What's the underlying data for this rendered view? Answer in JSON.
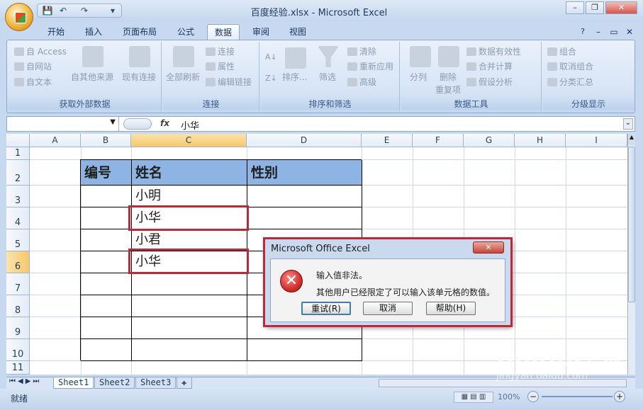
{
  "window": {
    "title": "百度经验.xlsx - Microsoft Excel",
    "minimize": "▭",
    "restore": "▭",
    "close": "✕"
  },
  "tabs": [
    "开始",
    "插入",
    "页面布局",
    "公式",
    "数据",
    "审阅",
    "视图"
  ],
  "active_tab": "数据",
  "ribbon": {
    "external": {
      "title": "获取外部数据",
      "access": "自 Access",
      "web": "自网站",
      "text": "自文本",
      "other": "自其他来源",
      "existing": "现有连接"
    },
    "connections": {
      "title": "连接",
      "refresh": "全部刷新",
      "conn": "连接",
      "props": "属性",
      "edit": "编辑链接"
    },
    "sort": {
      "title": "排序和筛选",
      "sort": "排序...",
      "filter": "筛选",
      "clear": "清除",
      "reapply": "重新应用",
      "advanced": "高级"
    },
    "tools": {
      "title": "数据工具",
      "split": "分列",
      "dedup1": "删除",
      "dedup2": "重复项",
      "validation": "数据有效性",
      "consolidate": "合并计算",
      "whatif": "假设分析"
    },
    "outline": {
      "title": "分级显示",
      "group": "组合",
      "ungroup": "取消组合",
      "subtotal": "分类汇总"
    }
  },
  "formula": {
    "fx": "fx",
    "value": "小华"
  },
  "columns": [
    "A",
    "B",
    "C",
    "D",
    "E",
    "F",
    "G",
    "H",
    "I"
  ],
  "selected_column": "C",
  "rows": [
    "1",
    "2",
    "3",
    "4",
    "5",
    "6",
    "7",
    "8",
    "9",
    "10",
    "11"
  ],
  "selected_row": "6",
  "table": {
    "headers": [
      "编号",
      "姓名",
      "性别"
    ],
    "names": [
      "小明",
      "小华",
      "小君",
      "小华",
      "",
      "",
      "",
      ""
    ]
  },
  "sheets": [
    "Sheet1",
    "Sheet2",
    "Sheet3"
  ],
  "status": {
    "ready": "就绪",
    "zoom": "100%"
  },
  "dialog": {
    "title": "Microsoft Office Excel",
    "msg1": "输入值非法。",
    "msg2": "其他用户已经限定了可以输入该单元格的数值。",
    "retry": "重试(R)",
    "cancel": "取消",
    "help": "帮助(H)",
    "close": "✕"
  },
  "watermark": {
    "brand": "Baidu经验",
    "url": "jingyan.baidu.com"
  }
}
